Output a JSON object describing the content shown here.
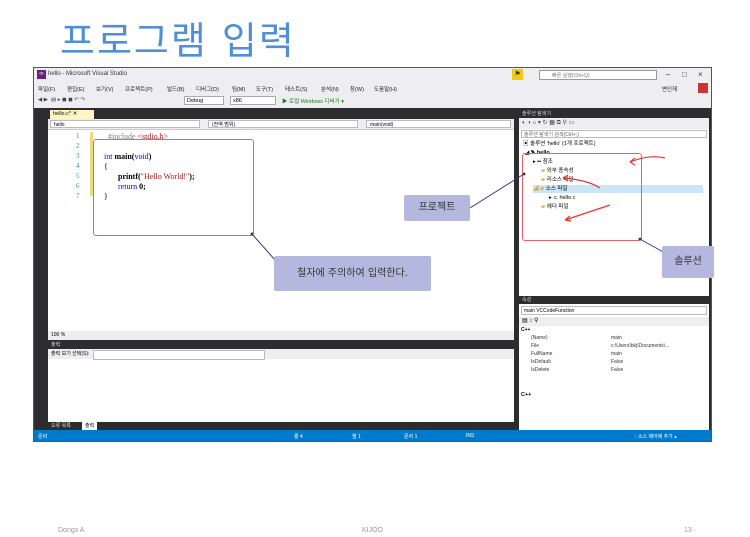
{
  "slide": {
    "title": "프로그램 입력",
    "footer_left": "Dongs A",
    "footer_center": "KIJOO",
    "footer_right": "13"
  },
  "window": {
    "title": "hello - Microsoft Visual Studio",
    "quick_launch_placeholder": "빠른 실행(Ctrl+Q)",
    "user_name": "변인재",
    "minimize": "–",
    "maximize": "□",
    "close": "×"
  },
  "menu": {
    "items": [
      "파일(F)",
      "편집(E)",
      "보기(V)",
      "프로젝트(P)",
      "빌드(B)",
      "디버그(D)",
      "팀(M)",
      "도구(T)",
      "테스트(S)",
      "분석(N)",
      "창(W)",
      "도움말(H)"
    ]
  },
  "toolbar": {
    "configuration": "Debug",
    "platform": "x86",
    "run_label": "▶ 로컬 Windows 디버거 ▾"
  },
  "editor": {
    "tab_label": "hello.c* ✕",
    "nav_project": "hello",
    "nav_scope": "(전역 범위)",
    "nav_member": "main(void)",
    "zoom": "100 %",
    "line_numbers": [
      "1",
      "2",
      "3",
      "4",
      "5",
      "6",
      "7"
    ],
    "code": {
      "line1_directive": "#include ",
      "line1_header": "<stdio.h>",
      "line3_kw1": "int",
      "line3_rest": " main(",
      "line3_kw2": "void",
      "line3_end": ")",
      "line4": "{",
      "line5_fn": "printf(",
      "line5_str": "\"Hello World!\"",
      "line5_end": ");",
      "line6_kw": "return",
      "line6_rest": " 0;",
      "line7": "}"
    }
  },
  "output_panel": {
    "header": "출력",
    "source_label": "출력 보기 선택(S):",
    "tabs": [
      "오류 목록",
      "출력"
    ]
  },
  "status_bar": {
    "ready": "준비",
    "line": "줄 4",
    "col": "열 1",
    "char": "문자 1",
    "ins": "INS",
    "publish": "↑ 소스 제어에 추가 ▴"
  },
  "solution_explorer": {
    "header": "솔루션 탐색기",
    "search_placeholder": "솔루션 탐색기 검색(Ctrl+;)",
    "items": [
      {
        "label": "솔루션 'hello' (1개 프로젝트)"
      },
      {
        "label": "hello"
      },
      {
        "label": "참조"
      },
      {
        "label": "외부 종속성"
      },
      {
        "label": "리소스 파일"
      },
      {
        "label": "소스 파일"
      },
      {
        "label": "hello.c"
      },
      {
        "label": "헤더 파일"
      }
    ]
  },
  "properties": {
    "header": "속성",
    "selector": "main VCCodeFunction",
    "category": "C++",
    "rows": [
      {
        "key": "(Name)",
        "value": "main"
      },
      {
        "key": "File",
        "value": "c:\\Users\\bkj\\Documents\\..."
      },
      {
        "key": "FullName",
        "value": "main"
      },
      {
        "key": "IsDefault",
        "value": "False"
      },
      {
        "key": "IsDelete",
        "value": "False"
      }
    ],
    "description": "C++"
  },
  "callouts": {
    "code_note": "철자에 주의하여 입력한다.",
    "project": "프로젝트",
    "solution": "솔루션"
  },
  "colors": {
    "title": "#4f8fd6",
    "callout_bg": "#b4b8de",
    "annotation_red": "#e8606c",
    "status_bar": "#007acc"
  }
}
